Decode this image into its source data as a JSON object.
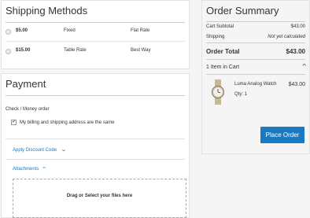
{
  "shipping": {
    "title": "Shipping Methods",
    "options": [
      {
        "price": "$5.00",
        "method": "Fixed",
        "carrier": "Flat Rate"
      },
      {
        "price": "$15.00",
        "method": "Table Rate",
        "carrier": "Best Way"
      }
    ]
  },
  "payment": {
    "title": "Payment",
    "method_label": "Check / Money order",
    "same_address_label": "My billing and shipping address are the same",
    "same_address_checked": true,
    "discount_label": "Apply Discount Code",
    "attachments_label": "Attachments",
    "dropzone_label": "Drag or Select your files here"
  },
  "summary": {
    "title": "Order Summary",
    "subtotal_label": "Cart Subtotal",
    "subtotal_value": "$43.00",
    "shipping_label": "Shipping",
    "shipping_value": "Not yet calculated",
    "total_label": "Order Total",
    "total_value": "$43.00",
    "items_in_cart": "1 Item in Cart",
    "item": {
      "name": "Luma Analog Watch",
      "price": "$43.00",
      "qty": "Qty: 1"
    },
    "place_order": "Place Order"
  },
  "colors": {
    "accent": "#1979c3"
  }
}
